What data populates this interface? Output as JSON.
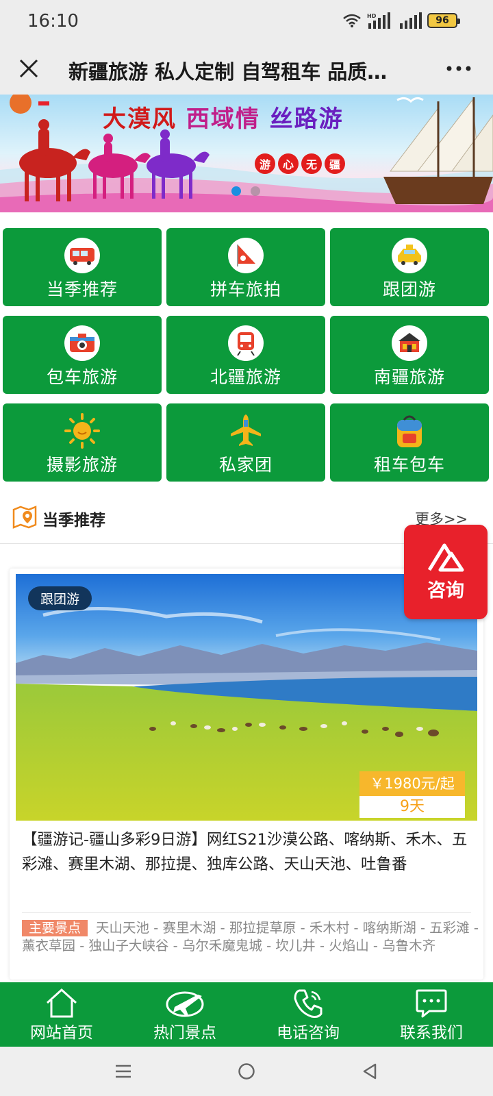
{
  "status_bar": {
    "time": "16:10",
    "battery": "96",
    "network_label": "HD"
  },
  "title_bar": {
    "title": "新疆旅游 私人定制 自驾租车 品质…"
  },
  "banner": {
    "headline_1": "大漠风",
    "headline_2": "西域情",
    "headline_3": "丝路游",
    "seal": [
      "游",
      "心",
      "无",
      "疆"
    ],
    "active_slide": 1,
    "slide_count": 2
  },
  "categories": [
    {
      "label": "当季推荐",
      "icon": "bus-icon"
    },
    {
      "label": "拼车旅拍",
      "icon": "flag-icon"
    },
    {
      "label": "跟团游",
      "icon": "taxi-icon"
    },
    {
      "label": "包车旅游",
      "icon": "camera-icon"
    },
    {
      "label": "北疆旅游",
      "icon": "train-icon"
    },
    {
      "label": "南疆旅游",
      "icon": "building-icon"
    },
    {
      "label": "摄影旅游",
      "icon": "sun-icon"
    },
    {
      "label": "私家团",
      "icon": "airplane-icon"
    },
    {
      "label": "租车包车",
      "icon": "backpack-icon"
    }
  ],
  "section": {
    "title": "当季推荐",
    "more": "更多>>"
  },
  "consult": {
    "label": "咨询"
  },
  "card": {
    "tag": "跟团游",
    "price": "￥1980元/起",
    "days": "9天",
    "title": "【疆游记-疆山多彩9日游】网红S21沙漠公路、喀纳斯、禾木、五彩滩、赛里木湖、那拉提、独库公路、天山天池、吐鲁番",
    "spots_label": "主要景点",
    "spots": "天山天池 - 赛里木湖 - 那拉提草原 - 禾木村 - 喀纳斯湖 - 五彩滩 - 薰衣草园 - 独山子大峡谷 - 乌尔禾魔鬼城 - 坎儿井 - 火焰山 - 乌鲁木齐"
  },
  "bottom_nav": [
    {
      "label": "网站首页",
      "icon": "home-icon"
    },
    {
      "label": "热门景点",
      "icon": "plane-globe-icon"
    },
    {
      "label": "电话咨询",
      "icon": "phone-icon"
    },
    {
      "label": "联系我们",
      "icon": "chat-icon"
    }
  ],
  "colors": {
    "green": "#0c9a3b",
    "red": "#e8212b",
    "price_yellow": "#f7b72c",
    "tag_navy": "#12355b"
  }
}
